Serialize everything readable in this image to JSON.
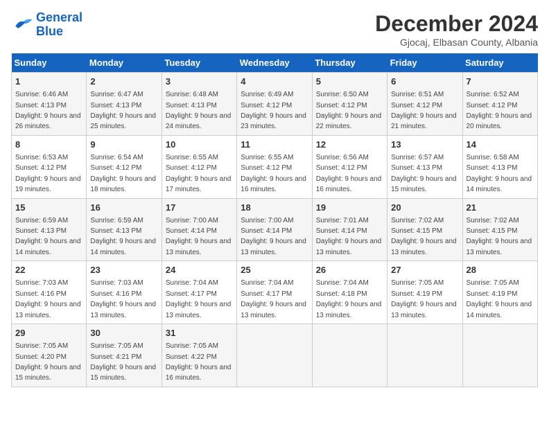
{
  "header": {
    "logo_general": "General",
    "logo_blue": "Blue",
    "month_title": "December 2024",
    "location": "Gjocaj, Elbasan County, Albania"
  },
  "weekdays": [
    "Sunday",
    "Monday",
    "Tuesday",
    "Wednesday",
    "Thursday",
    "Friday",
    "Saturday"
  ],
  "weeks": [
    [
      {
        "day": "1",
        "sunrise": "Sunrise: 6:46 AM",
        "sunset": "Sunset: 4:13 PM",
        "daylight": "Daylight: 9 hours and 26 minutes."
      },
      {
        "day": "2",
        "sunrise": "Sunrise: 6:47 AM",
        "sunset": "Sunset: 4:13 PM",
        "daylight": "Daylight: 9 hours and 25 minutes."
      },
      {
        "day": "3",
        "sunrise": "Sunrise: 6:48 AM",
        "sunset": "Sunset: 4:13 PM",
        "daylight": "Daylight: 9 hours and 24 minutes."
      },
      {
        "day": "4",
        "sunrise": "Sunrise: 6:49 AM",
        "sunset": "Sunset: 4:12 PM",
        "daylight": "Daylight: 9 hours and 23 minutes."
      },
      {
        "day": "5",
        "sunrise": "Sunrise: 6:50 AM",
        "sunset": "Sunset: 4:12 PM",
        "daylight": "Daylight: 9 hours and 22 minutes."
      },
      {
        "day": "6",
        "sunrise": "Sunrise: 6:51 AM",
        "sunset": "Sunset: 4:12 PM",
        "daylight": "Daylight: 9 hours and 21 minutes."
      },
      {
        "day": "7",
        "sunrise": "Sunrise: 6:52 AM",
        "sunset": "Sunset: 4:12 PM",
        "daylight": "Daylight: 9 hours and 20 minutes."
      }
    ],
    [
      {
        "day": "8",
        "sunrise": "Sunrise: 6:53 AM",
        "sunset": "Sunset: 4:12 PM",
        "daylight": "Daylight: 9 hours and 19 minutes."
      },
      {
        "day": "9",
        "sunrise": "Sunrise: 6:54 AM",
        "sunset": "Sunset: 4:12 PM",
        "daylight": "Daylight: 9 hours and 18 minutes."
      },
      {
        "day": "10",
        "sunrise": "Sunrise: 6:55 AM",
        "sunset": "Sunset: 4:12 PM",
        "daylight": "Daylight: 9 hours and 17 minutes."
      },
      {
        "day": "11",
        "sunrise": "Sunrise: 6:55 AM",
        "sunset": "Sunset: 4:12 PM",
        "daylight": "Daylight: 9 hours and 16 minutes."
      },
      {
        "day": "12",
        "sunrise": "Sunrise: 6:56 AM",
        "sunset": "Sunset: 4:12 PM",
        "daylight": "Daylight: 9 hours and 16 minutes."
      },
      {
        "day": "13",
        "sunrise": "Sunrise: 6:57 AM",
        "sunset": "Sunset: 4:13 PM",
        "daylight": "Daylight: 9 hours and 15 minutes."
      },
      {
        "day": "14",
        "sunrise": "Sunrise: 6:58 AM",
        "sunset": "Sunset: 4:13 PM",
        "daylight": "Daylight: 9 hours and 14 minutes."
      }
    ],
    [
      {
        "day": "15",
        "sunrise": "Sunrise: 6:59 AM",
        "sunset": "Sunset: 4:13 PM",
        "daylight": "Daylight: 9 hours and 14 minutes."
      },
      {
        "day": "16",
        "sunrise": "Sunrise: 6:59 AM",
        "sunset": "Sunset: 4:13 PM",
        "daylight": "Daylight: 9 hours and 14 minutes."
      },
      {
        "day": "17",
        "sunrise": "Sunrise: 7:00 AM",
        "sunset": "Sunset: 4:14 PM",
        "daylight": "Daylight: 9 hours and 13 minutes."
      },
      {
        "day": "18",
        "sunrise": "Sunrise: 7:00 AM",
        "sunset": "Sunset: 4:14 PM",
        "daylight": "Daylight: 9 hours and 13 minutes."
      },
      {
        "day": "19",
        "sunrise": "Sunrise: 7:01 AM",
        "sunset": "Sunset: 4:14 PM",
        "daylight": "Daylight: 9 hours and 13 minutes."
      },
      {
        "day": "20",
        "sunrise": "Sunrise: 7:02 AM",
        "sunset": "Sunset: 4:15 PM",
        "daylight": "Daylight: 9 hours and 13 minutes."
      },
      {
        "day": "21",
        "sunrise": "Sunrise: 7:02 AM",
        "sunset": "Sunset: 4:15 PM",
        "daylight": "Daylight: 9 hours and 13 minutes."
      }
    ],
    [
      {
        "day": "22",
        "sunrise": "Sunrise: 7:03 AM",
        "sunset": "Sunset: 4:16 PM",
        "daylight": "Daylight: 9 hours and 13 minutes."
      },
      {
        "day": "23",
        "sunrise": "Sunrise: 7:03 AM",
        "sunset": "Sunset: 4:16 PM",
        "daylight": "Daylight: 9 hours and 13 minutes."
      },
      {
        "day": "24",
        "sunrise": "Sunrise: 7:04 AM",
        "sunset": "Sunset: 4:17 PM",
        "daylight": "Daylight: 9 hours and 13 minutes."
      },
      {
        "day": "25",
        "sunrise": "Sunrise: 7:04 AM",
        "sunset": "Sunset: 4:17 PM",
        "daylight": "Daylight: 9 hours and 13 minutes."
      },
      {
        "day": "26",
        "sunrise": "Sunrise: 7:04 AM",
        "sunset": "Sunset: 4:18 PM",
        "daylight": "Daylight: 9 hours and 13 minutes."
      },
      {
        "day": "27",
        "sunrise": "Sunrise: 7:05 AM",
        "sunset": "Sunset: 4:19 PM",
        "daylight": "Daylight: 9 hours and 13 minutes."
      },
      {
        "day": "28",
        "sunrise": "Sunrise: 7:05 AM",
        "sunset": "Sunset: 4:19 PM",
        "daylight": "Daylight: 9 hours and 14 minutes."
      }
    ],
    [
      {
        "day": "29",
        "sunrise": "Sunrise: 7:05 AM",
        "sunset": "Sunset: 4:20 PM",
        "daylight": "Daylight: 9 hours and 15 minutes."
      },
      {
        "day": "30",
        "sunrise": "Sunrise: 7:05 AM",
        "sunset": "Sunset: 4:21 PM",
        "daylight": "Daylight: 9 hours and 15 minutes."
      },
      {
        "day": "31",
        "sunrise": "Sunrise: 7:05 AM",
        "sunset": "Sunset: 4:22 PM",
        "daylight": "Daylight: 9 hours and 16 minutes."
      },
      null,
      null,
      null,
      null
    ]
  ]
}
